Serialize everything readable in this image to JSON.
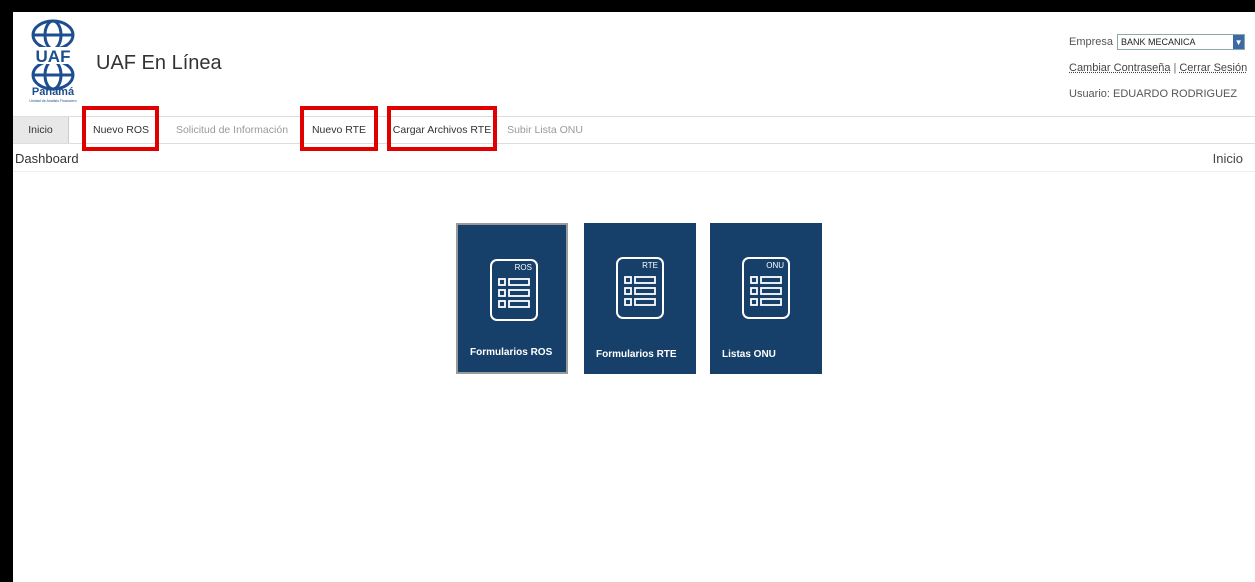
{
  "header": {
    "app_title": "UAF En Línea",
    "logo_text": "UAF",
    "logo_country": "Panamá",
    "logo_subtitle": "Unidad de Análisis Financiero",
    "company_label": "Empresa",
    "company_value": "BANK MECANICA",
    "change_password": "Cambiar Contraseña",
    "separator": "|",
    "logout": "Cerrar Sesión",
    "user_label": "Usuario: EDUARDO RODRIGUEZ"
  },
  "nav": {
    "tabs": [
      {
        "label": "Inicio"
      },
      {
        "label": "Nuevo ROS"
      },
      {
        "label": "Solicitud de Información"
      },
      {
        "label": "Nuevo RTE"
      },
      {
        "label": "Cargar Archivos RTE"
      },
      {
        "label": "Subir Lista ONU"
      }
    ]
  },
  "breadcrumb": {
    "left": "Dashboard",
    "right": "Inicio"
  },
  "tiles": [
    {
      "code": "ROS",
      "label": "Formularios ROS"
    },
    {
      "code": "RTE",
      "label": "Formularios RTE"
    },
    {
      "code": "ONU",
      "label": "Listas ONU"
    }
  ],
  "colors": {
    "tile_bg": "#16406a",
    "highlight": "#e00000",
    "frame": "#000000"
  }
}
